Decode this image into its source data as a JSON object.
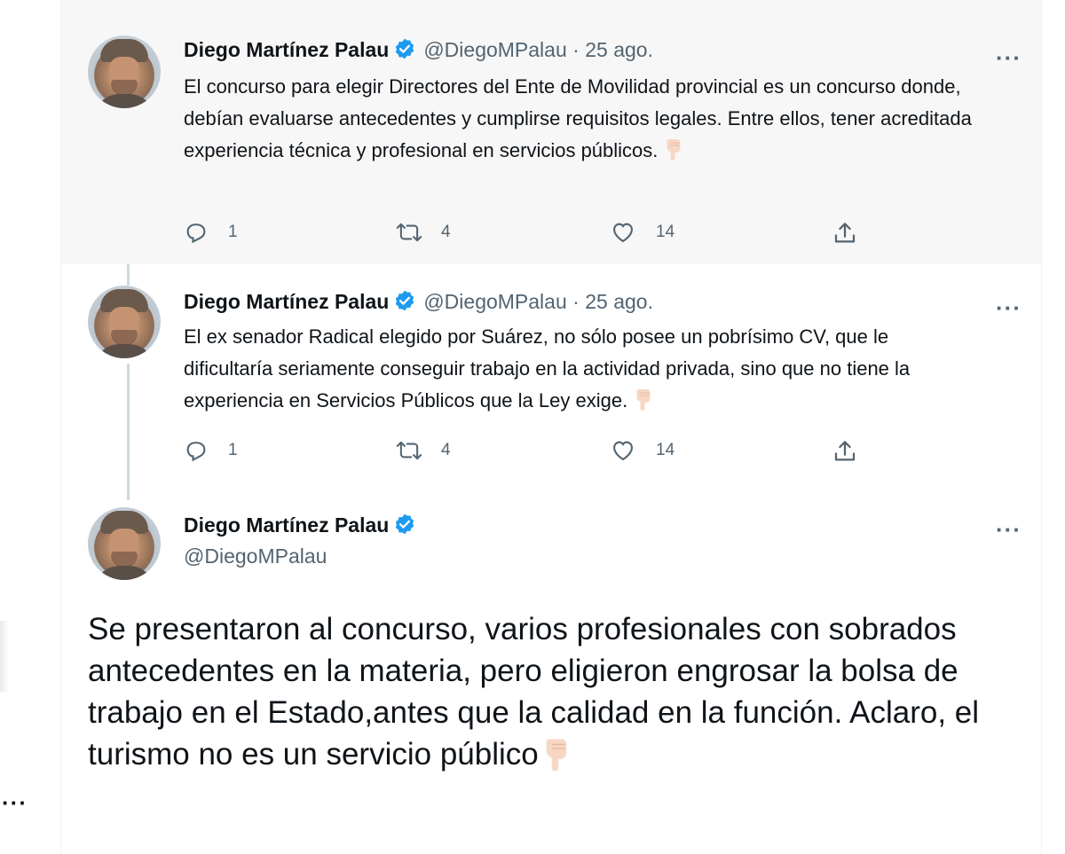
{
  "tweets": [
    {
      "name": "Diego Martínez Palau",
      "handle": "@DiegoMPalau",
      "separator": "·",
      "date": "25 ago.",
      "text": "El concurso para elegir Directores del Ente de Movilidad provincial es un concurso donde, debían evaluarse antecedentes y cumplirse requisitos legales. Entre ellos, tener acreditada experiencia técnica y profesional en servicios públicos.",
      "replies": "1",
      "retweets": "4",
      "likes": "14"
    },
    {
      "name": "Diego Martínez Palau",
      "handle": "@DiegoMPalau",
      "separator": "·",
      "date": "25 ago.",
      "text": "El ex senador Radical elegido por Suárez, no sólo posee un pobrísimo CV, que le dificultaría seriamente conseguir trabajo en la actividad privada, sino que no tiene la experiencia en Servicios Públicos que la Ley exige.",
      "replies": "1",
      "retweets": "4",
      "likes": "14"
    }
  ],
  "focused_tweet": {
    "name": "Diego Martínez Palau",
    "handle": "@DiegoMPalau",
    "text": "Se presentaron al concurso, varios profesionales con sobrados antecedentes en la materia, pero eligieron engrosar la bolsa de trabajo en el Estado,antes que la calidad en la función. Aclaro, el turismo no es un servicio público"
  },
  "more_label": "···",
  "left_more_label": "···",
  "icons": {
    "verified": "verified-badge-icon",
    "reply": "reply-icon",
    "retweet": "retweet-icon",
    "like": "heart-icon",
    "share": "share-icon",
    "emoji": "backhand-index-pointing-down-icon"
  },
  "colors": {
    "verified": "#1d9bf0",
    "secondary_text": "#536471",
    "hover_bg": "#f7f7f7",
    "thread_line": "#cfd9de"
  }
}
